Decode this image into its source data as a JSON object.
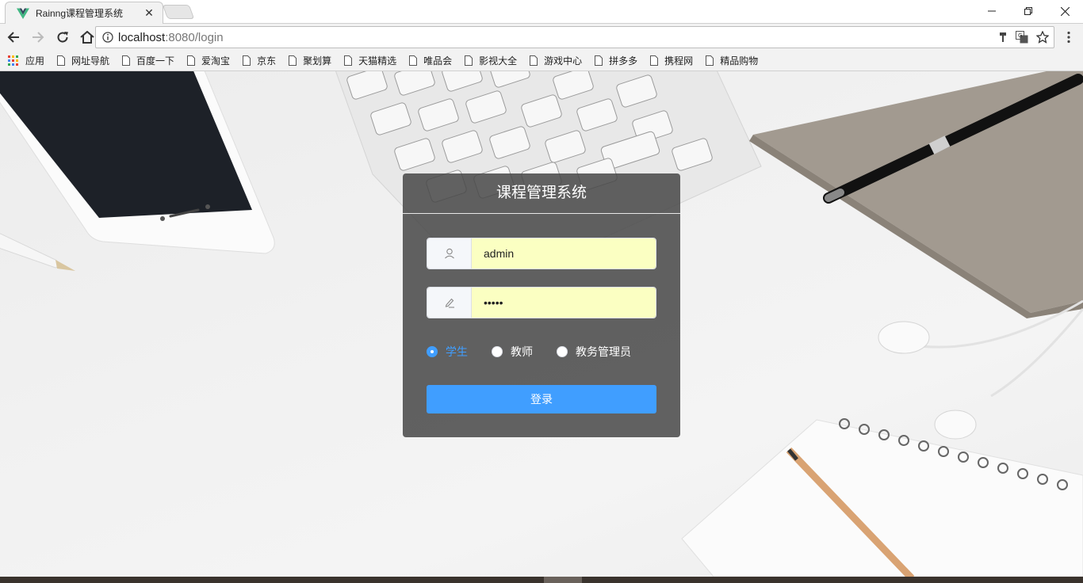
{
  "browser": {
    "tab_title": "Rainng课程管理系统",
    "tab_close": "✕",
    "url_host": "localhost",
    "url_rest": ":8080/login",
    "bookmarks": [
      "应用",
      "网址导航",
      "百度一下",
      "爱淘宝",
      "京东",
      "聚划算",
      "天猫精选",
      "唯品会",
      "影视大全",
      "游戏中心",
      "拼多多",
      "携程网",
      "精品购物"
    ]
  },
  "login": {
    "title": "课程管理系统",
    "username_value": "admin",
    "password_value": "admin",
    "roles": [
      "学生",
      "教师",
      "教务管理员"
    ],
    "selected_role": "学生",
    "submit_label": "登录"
  },
  "colors": {
    "primary": "#409eff",
    "autofill": "#fbffc2",
    "card": "#4a4a4a"
  }
}
